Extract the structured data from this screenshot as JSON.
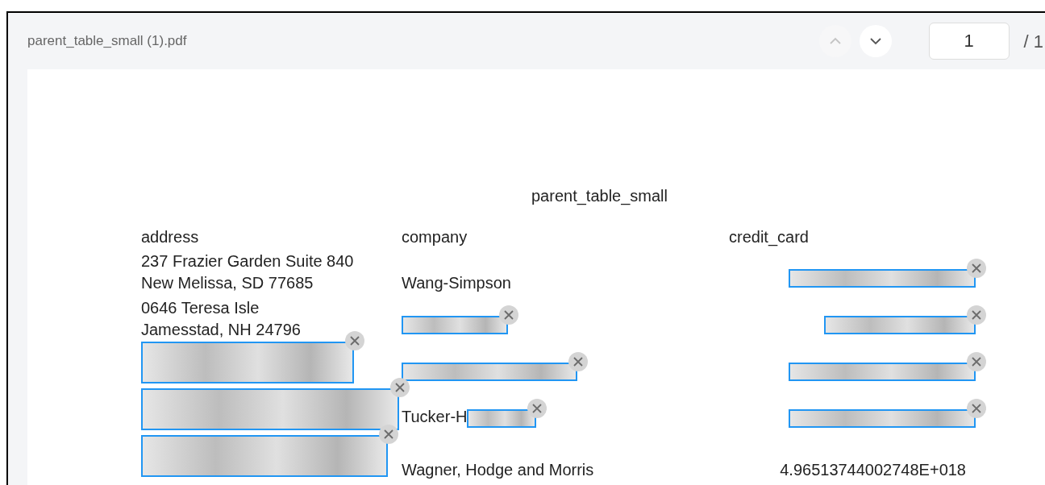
{
  "viewer": {
    "file_name": "parent_table_small (1).pdf",
    "prev_page": {
      "disabled": true
    },
    "next_page": {
      "disabled": false
    },
    "page_number": "1",
    "page_total": "/ 1"
  },
  "document": {
    "title": "parent_table_small",
    "columns": [
      "address",
      "company",
      "credit_card"
    ],
    "rows": [
      {
        "cells": [
          {
            "lines": [
              "237 Frazier Garden Suite 840",
              "New Melissa, SD 77685"
            ],
            "redacted": false
          },
          {
            "lines": [
              "Wang-Simpson"
            ],
            "redacted": false
          },
          {
            "redacted": true
          }
        ]
      },
      {
        "cells": [
          {
            "lines": [
              "0646 Teresa Isle",
              "Jamesstad, NH 24796"
            ],
            "redacted": false
          },
          {
            "redacted": true
          },
          {
            "redacted": true
          }
        ]
      },
      {
        "cells": [
          {
            "redacted": true
          },
          {
            "redacted": true
          },
          {
            "redacted": true
          }
        ]
      },
      {
        "cells": [
          {
            "redacted": true
          },
          {
            "lines": [
              "Tucker-H"
            ],
            "redacted": true
          },
          {
            "redacted": true
          }
        ]
      },
      {
        "cells": [
          {
            "redacted": true
          },
          {
            "lines": [
              "Wagner, Hodge and Morris"
            ],
            "redacted": false
          },
          {
            "lines": [
              "4.96513744002748E+018"
            ],
            "redacted": false
          }
        ]
      }
    ]
  }
}
